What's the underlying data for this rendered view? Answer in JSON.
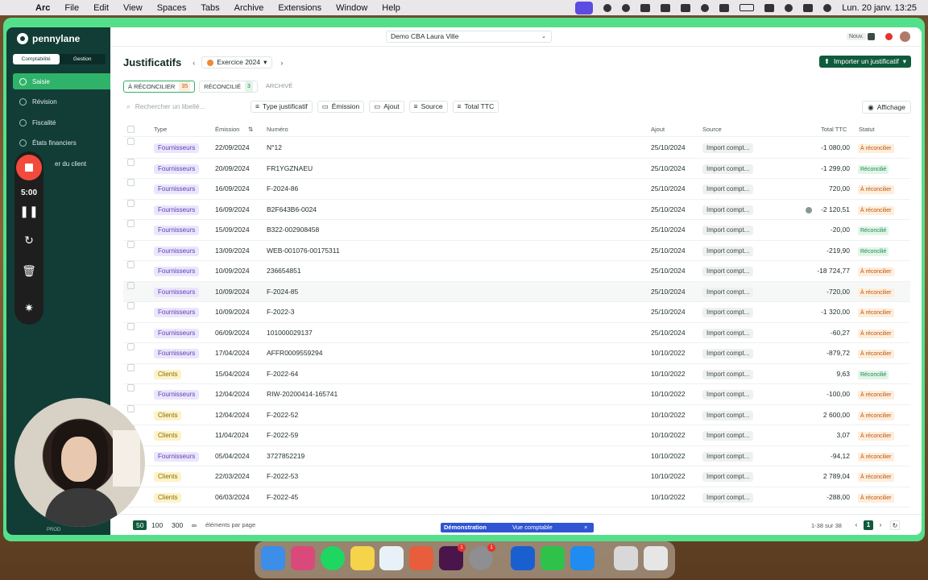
{
  "menubar": {
    "app": "Arc",
    "items": [
      "File",
      "Edit",
      "View",
      "Spaces",
      "Tabs",
      "Archive",
      "Extensions",
      "Window",
      "Help"
    ],
    "clock": "Lun. 20 janv.  13:25"
  },
  "sidebar": {
    "brand": "pennylane",
    "segments": [
      "Comptabilité",
      "Gestion"
    ],
    "items": [
      {
        "label": "Saisie",
        "icon": "pencil-icon"
      },
      {
        "label": "Révision",
        "icon": "eye-icon"
      },
      {
        "label": "Fiscalité",
        "icon": "tax-icon"
      },
      {
        "label": "États financiers",
        "icon": "report-icon"
      },
      {
        "label": "er du client",
        "icon": "client-icon"
      }
    ],
    "footer": "PROD"
  },
  "recorder": {
    "time": "5:00"
  },
  "header": {
    "company": "Demo CBA Laura Ville",
    "nouv": "Nouv."
  },
  "page": {
    "title": "Justificatifs",
    "exercise": "Exercice 2024",
    "import_button": "Importer un justificatif",
    "tabs": [
      {
        "label": "À RÉCONCILIER",
        "count": "35"
      },
      {
        "label": "RÉCONCILIÉ",
        "count": "3"
      },
      {
        "label": "ARCHIVÉ",
        "count": ""
      }
    ],
    "search_placeholder": "Rechercher un libellé...",
    "filters": [
      "Type justificatif",
      "Émission",
      "Ajout",
      "Source",
      "Total TTC"
    ],
    "display_button": "Affichage"
  },
  "table": {
    "columns": [
      "Type",
      "Émission",
      "Numéro",
      "Ajout",
      "Source",
      "Total TTC",
      "Statut"
    ],
    "rows": [
      {
        "type": "Fournisseurs",
        "emission": "22/09/2024",
        "numero": "N°12",
        "ajout": "25/10/2024",
        "source": "Import compt...",
        "total": "-1 080,00",
        "statut": "À réconcilier"
      },
      {
        "type": "Fournisseurs",
        "emission": "20/09/2024",
        "numero": "FR1YGZNAEU",
        "ajout": "25/10/2024",
        "source": "Import compt...",
        "total": "-1 299,00",
        "statut": "Réconcilié"
      },
      {
        "type": "Fournisseurs",
        "emission": "16/09/2024",
        "numero": "F-2024-86",
        "ajout": "25/10/2024",
        "source": "Import compt...",
        "total": "720,00",
        "statut": "À réconcilier"
      },
      {
        "type": "Fournisseurs",
        "emission": "16/09/2024",
        "numero": "B2F643B6-0024",
        "ajout": "25/10/2024",
        "source": "Import compt...",
        "total": "-2 120,51",
        "statut": "À réconcilier"
      },
      {
        "type": "Fournisseurs",
        "emission": "15/09/2024",
        "numero": "B322-002908458",
        "ajout": "25/10/2024",
        "source": "Import compt...",
        "total": "-20,00",
        "statut": "Réconcilié"
      },
      {
        "type": "Fournisseurs",
        "emission": "13/09/2024",
        "numero": "WEB-001076-00175311",
        "ajout": "25/10/2024",
        "source": "Import compt...",
        "total": "-219,90",
        "statut": "Réconcilié"
      },
      {
        "type": "Fournisseurs",
        "emission": "10/09/2024",
        "numero": "236654851",
        "ajout": "25/10/2024",
        "source": "Import compt...",
        "total": "-18 724,77",
        "statut": "À réconcilier"
      },
      {
        "type": "Fournisseurs",
        "emission": "10/09/2024",
        "numero": "F-2024-85",
        "ajout": "25/10/2024",
        "source": "Import compt...",
        "total": "-720,00",
        "statut": "À réconcilier"
      },
      {
        "type": "Fournisseurs",
        "emission": "10/09/2024",
        "numero": "F-2022-3",
        "ajout": "25/10/2024",
        "source": "Import compt...",
        "total": "-1 320,00",
        "statut": "À réconcilier"
      },
      {
        "type": "Fournisseurs",
        "emission": "06/09/2024",
        "numero": "101000029137",
        "ajout": "25/10/2024",
        "source": "Import compt...",
        "total": "-60,27",
        "statut": "À réconcilier"
      },
      {
        "type": "Fournisseurs",
        "emission": "17/04/2024",
        "numero": "AFFR0009559294",
        "ajout": "10/10/2022",
        "source": "Import compt...",
        "total": "-879,72",
        "statut": "À réconcilier"
      },
      {
        "type": "Clients",
        "emission": "15/04/2024",
        "numero": "F-2022-64",
        "ajout": "10/10/2022",
        "source": "Import compt...",
        "total": "9,63",
        "statut": "Réconcilié"
      },
      {
        "type": "Fournisseurs",
        "emission": "12/04/2024",
        "numero": "RIW-20200414-165741",
        "ajout": "10/10/2022",
        "source": "Import compt...",
        "total": "-100,00",
        "statut": "À réconcilier"
      },
      {
        "type": "Clients",
        "emission": "12/04/2024",
        "numero": "F-2022-52",
        "ajout": "10/10/2022",
        "source": "Import compt...",
        "total": "2 600,00",
        "statut": "À réconcilier"
      },
      {
        "type": "Clients",
        "emission": "11/04/2024",
        "numero": "F-2022-59",
        "ajout": "10/10/2022",
        "source": "Import compt...",
        "total": "3,07",
        "statut": "À réconcilier"
      },
      {
        "type": "Fournisseurs",
        "emission": "05/04/2024",
        "numero": "3727852219",
        "ajout": "10/10/2022",
        "source": "Import compt...",
        "total": "-94,12",
        "statut": "À réconcilier"
      },
      {
        "type": "Clients",
        "emission": "22/03/2024",
        "numero": "F-2022-53",
        "ajout": "10/10/2022",
        "source": "Import compt...",
        "total": "2 789,04",
        "statut": "À réconcilier"
      },
      {
        "type": "Clients",
        "emission": "06/03/2024",
        "numero": "F-2022-45",
        "ajout": "10/10/2022",
        "source": "Import compt...",
        "total": "-288,00",
        "statut": "À réconcilier"
      }
    ]
  },
  "footer": {
    "page_sizes": [
      "50",
      "100",
      "300",
      "∞"
    ],
    "per_page_label": "éléments par page",
    "demo_label": "Démonstration",
    "view_label": "Vue comptable",
    "range": "1-38 sur 38",
    "current_page": "1"
  }
}
